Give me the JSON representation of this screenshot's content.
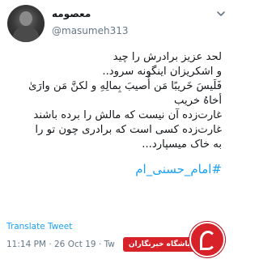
{
  "user": {
    "display_name": "معصومه",
    "handle": "@masumeh313"
  },
  "tweet": {
    "lines": [
      "لحد عزیز برادرش را چید",
      "و اشکریزان اینگونه سرود..",
      "فَلَیسَ خَریبًا مَن أُصیبَ بِمالِهِ و لکنَّ مَن وارَیٰ",
      "أخاهُ خریب"
    ],
    "lines2": [
      "غارت‌زده آن نیست که مالش را برده باشند",
      "غارت‌زده کسی است که برادری چون تو را",
      "به خاک میسپارد..."
    ],
    "hashtag": "#امام_حسنی_ام"
  },
  "footer": {
    "translate_label": "Translate Tweet",
    "timestamp": "11:14 PM · 26 Oct 19 · Tw"
  },
  "watermark": {
    "text": "باشگاه خبرنگاران"
  },
  "icons": {
    "menu": "chevron-down-icon",
    "logo": "watermark-logo-icon"
  },
  "colors": {
    "link": "#1da1f2",
    "secondary": "#657786",
    "watermark": "#d7222a"
  }
}
